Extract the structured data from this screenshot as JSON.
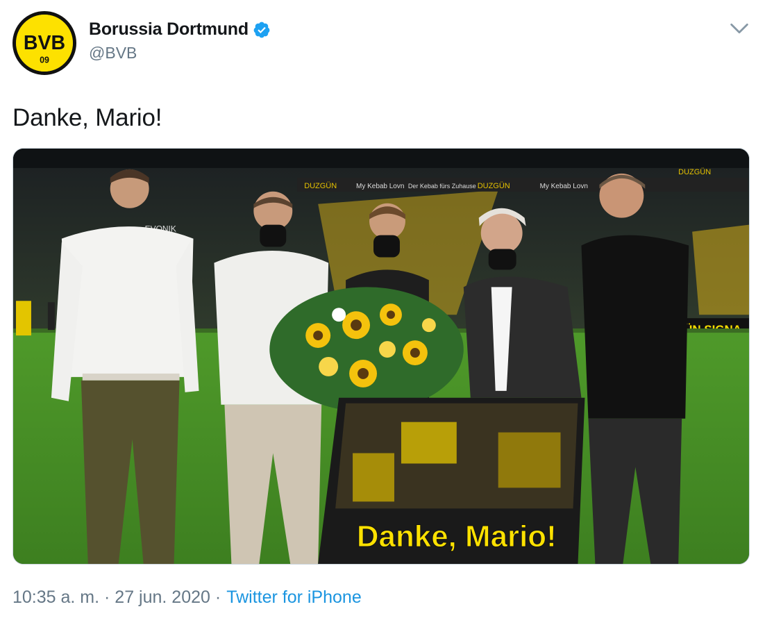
{
  "account": {
    "display_name": "Borussia Dortmund",
    "handle": "@BVB",
    "verified": true,
    "avatar_logo_text": "BVB",
    "avatar_logo_year": "09"
  },
  "tweet": {
    "text": "Danke, Mario!",
    "timestamp": "10:35 a. m. · 27 jun. 2020 ·",
    "source": "Twitter for iPhone"
  },
  "media": {
    "board_text": "Danke, Mario!",
    "ad_boards": [
      "DUZGÜN",
      "My Kebab Lovn",
      "Der Kebab fürs Zuhause",
      "DUZGÜN",
      "My Kebab Lovn",
      "DUZGÜN",
      "EVONIK",
      "ÜN SIGNA"
    ]
  },
  "icons": {
    "verified": "verified-badge-icon",
    "more": "chevron-down-icon"
  },
  "colors": {
    "bvb_yellow": "#fde100",
    "twitter_blue": "#1da1f2",
    "link_blue": "#1b95e0",
    "secondary_text": "#657786"
  }
}
